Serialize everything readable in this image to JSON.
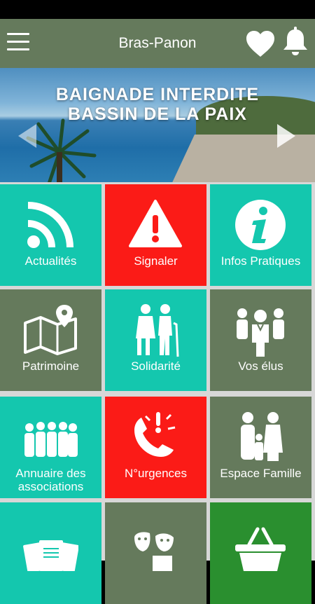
{
  "header": {
    "title": "Bras-Panon"
  },
  "banner": {
    "line1": "BAIGNADE INTERDITE",
    "line2": "BASSIN DE LA PAIX"
  },
  "tiles": [
    {
      "label": "Actualités",
      "icon": "rss-icon",
      "color": "#14c7ae"
    },
    {
      "label": "Signaler",
      "icon": "warning-icon",
      "color": "#fb1b17"
    },
    {
      "label": "Infos Pratiques",
      "icon": "info-icon",
      "color": "#14c7ae"
    },
    {
      "label": "Patrimoine",
      "icon": "map-icon",
      "color": "#657a5c"
    },
    {
      "label": "Solidarité",
      "icon": "elderly-couple-icon",
      "color": "#14c7ae"
    },
    {
      "label": "Vos élus",
      "icon": "group-icon",
      "color": "#657a5c"
    },
    {
      "label": "Annuaire des associations",
      "icon": "people-row-icon",
      "color": "#14c7ae"
    },
    {
      "label": "N°urgences",
      "icon": "phone-alert-icon",
      "color": "#fb1b17"
    },
    {
      "label": "Espace Famille",
      "icon": "family-icon",
      "color": "#657a5c"
    },
    {
      "label": "",
      "icon": "documents-icon",
      "color": "#14c7ae"
    },
    {
      "label": "",
      "icon": "theater-masks-icon",
      "color": "#657a5c"
    },
    {
      "label": "",
      "icon": "basket-icon",
      "color": "#2a8f2f"
    }
  ]
}
